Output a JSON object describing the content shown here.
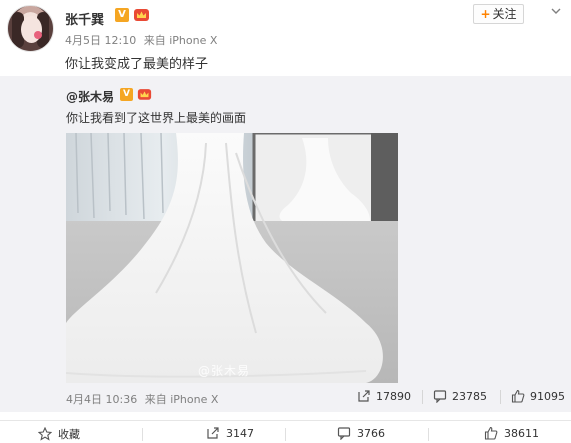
{
  "post": {
    "author": "张千巽",
    "verified_badge": "V",
    "date": "4月5日 12:10",
    "source_prefix": "来自",
    "device": "iPhone X",
    "text": "你让我变成了最美的样子",
    "follow_label": "关注",
    "follow_plus": "+"
  },
  "repost": {
    "author": "@张木易",
    "verified_badge": "V",
    "text": "你让我看到了这世界上最美的画面",
    "image_watermark": "@张木易",
    "date": "4月4日 10:36",
    "source_prefix": "来自",
    "device": "iPhone X",
    "stats": {
      "forwards": "17890",
      "comments": "23785",
      "likes": "91095"
    }
  },
  "actions": {
    "favorite_label": "收藏",
    "forwards": "3147",
    "comments": "3766",
    "likes": "38611"
  },
  "colors": {
    "accent": "#ff8200",
    "badge": "#f5a623",
    "repost_bg": "#f2f2f5",
    "meta_text": "#808080"
  }
}
